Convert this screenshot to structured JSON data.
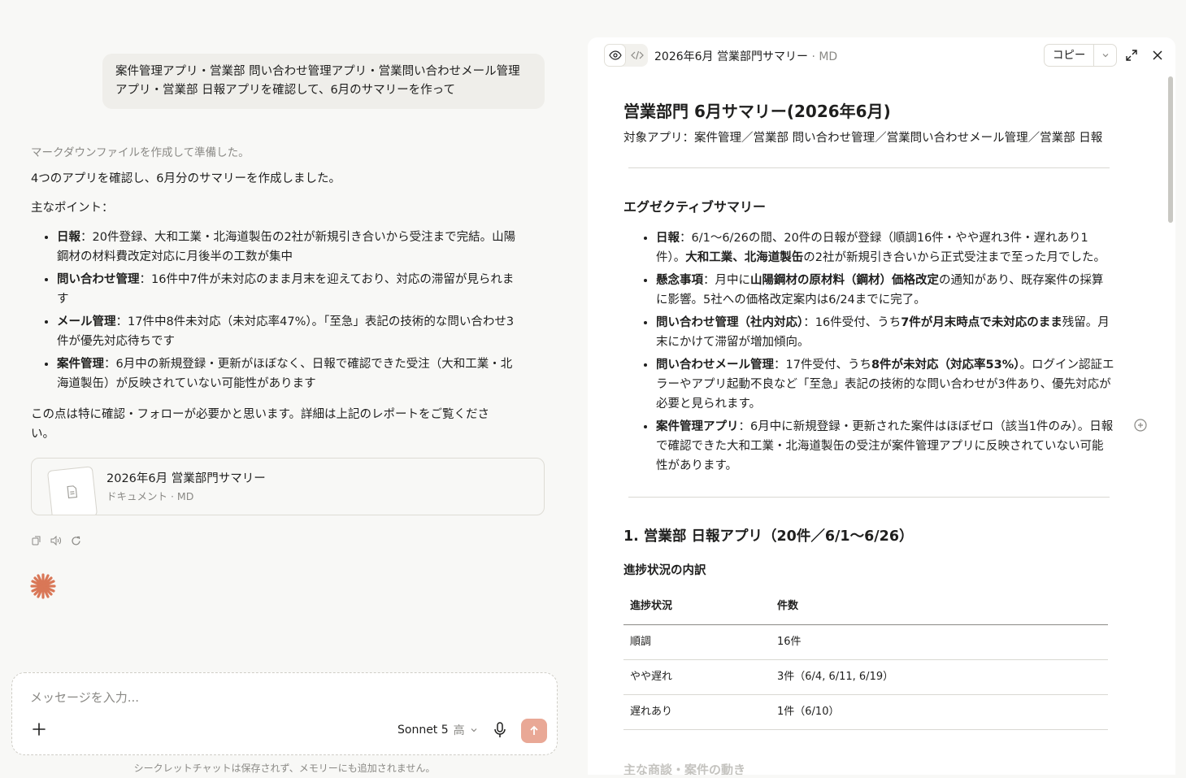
{
  "chat": {
    "user_message": "案件管理アプリ・営業部 問い合わせ管理アプリ・営業問い合わせメール管理アプリ・営業部 日報アプリを確認して、6月のサマリーを作って",
    "status": "マークダウンファイルを作成して準備した。",
    "intro": "4つのアプリを確認し、6月分のサマリーを作成しました。",
    "points_heading": "主なポイント：",
    "points": [
      {
        "title": "日報",
        "text": "：20件登録、大和工業・北海道製缶の2社が新規引き合いから受注まで完結。山陽鋼材の材料費改定対応に月後半の工数が集中"
      },
      {
        "title": "問い合わせ管理",
        "text": "：16件中7件が未対応のまま月末を迎えており、対応の滞留が見られます"
      },
      {
        "title": "メール管理",
        "text": "：17件中8件未対応（未対応率47%）。「至急」表記の技術的な問い合わせ3件が優先対応待ちです"
      },
      {
        "title": "案件管理",
        "text": "：6月中の新規登録・更新がほぼなく、日報で確認できた受注（大和工業・北海道製缶）が反映されていない可能性があります"
      }
    ],
    "closing": "この点は特に確認・フォローが必要かと思います。詳細は上記のレポートをご覧ください。",
    "attachment": {
      "title": "2026年6月 営業部門サマリー",
      "subtitle": "ドキュメント · MD"
    },
    "composer": {
      "placeholder": "メッセージを入力...",
      "model": "Sonnet 5",
      "effort": "高"
    },
    "footnote": "シークレットチャットは保存されず、メモリーにも追加されません。"
  },
  "panel": {
    "title": "2026年6月 営業部門サマリー",
    "ext": " · MD",
    "copy_label": "コピー",
    "doc": {
      "h1": "営業部門 6月サマリー(2026年6月)",
      "subtitle": "対象アプリ：案件管理／営業部 問い合わせ管理／営業問い合わせメール管理／営業部 日報",
      "exec_heading": "エグゼクティブサマリー",
      "exec_items": [
        {
          "parts": [
            {
              "b": "日報"
            },
            {
              "t": "：6/1〜6/26の間、20件の日報が登録（順調16件・やや遅れ3件・遅れあり1件）。"
            },
            {
              "b": "大和工業、北海道製缶"
            },
            {
              "t": "の2社が新規引き合いから正式受注まで至った月でした。"
            }
          ]
        },
        {
          "parts": [
            {
              "b": "懸念事項"
            },
            {
              "t": "：月中に"
            },
            {
              "b": "山陽鋼材の原材料（鋼材）価格改定"
            },
            {
              "t": "の通知があり、既存案件の採算に影響。5社への価格改定案内は6/24までに完了。"
            }
          ]
        },
        {
          "parts": [
            {
              "b": "問い合わせ管理（社内対応）"
            },
            {
              "t": "：16件受付、うち"
            },
            {
              "b": "7件が月末時点で未対応のまま"
            },
            {
              "t": "残留。月末にかけて滞留が増加傾向。"
            }
          ]
        },
        {
          "parts": [
            {
              "b": "問い合わせメール管理"
            },
            {
              "t": "：17件受付、うち"
            },
            {
              "b": "8件が未対応（対応率53%）"
            },
            {
              "t": "。ログイン認証エラーやアプリ起動不良など「至急」表記の技術的な問い合わせが3件あり、優先対応が必要と見られます。"
            }
          ]
        },
        {
          "parts": [
            {
              "b": "案件管理アプリ"
            },
            {
              "t": "：6月中に新規登録・更新された案件はほぼゼロ（該当1件のみ）。日報で確認できた大和工業・北海道製缶の受注が案件管理アプリに反映されていない可能性があります。"
            }
          ]
        }
      ],
      "section1_heading": "1. 営業部 日報アプリ（20件／6/1〜6/26）",
      "progress_heading": "進捗状況の内訳",
      "table": {
        "headers": [
          "進捗状況",
          "件数"
        ],
        "rows": [
          [
            "順調",
            "16件"
          ],
          [
            "やや遅れ",
            "3件（6/4, 6/11, 6/19）"
          ],
          [
            "遅れあり",
            "1件（6/10）"
          ]
        ]
      },
      "next_heading_faded": "主な商談・案件の動き"
    }
  },
  "colors": {
    "accent": "#d97757",
    "send_button": "#e9a896"
  }
}
